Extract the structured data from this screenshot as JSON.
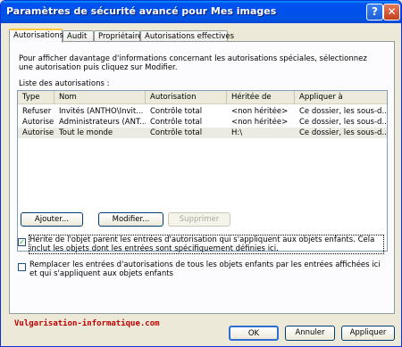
{
  "window": {
    "title": "Paramètres de sécurité avancé pour Mes images"
  },
  "titlebar_buttons": {
    "help": "?",
    "close": "✕"
  },
  "tabs": [
    {
      "label": "Autorisations",
      "active": true
    },
    {
      "label": "Audit",
      "active": false
    },
    {
      "label": "Propriétaire",
      "active": false
    },
    {
      "label": "Autorisations effectives",
      "active": false
    }
  ],
  "intro_text": "Pour afficher davantage d'informations concernant les autorisations spéciales, sélectionnez une autorisation puis cliquez sur Modifier.",
  "list_caption": "Liste des autorisations :",
  "columns": [
    "Type",
    "Nom",
    "Autorisation",
    "Héritée de",
    "Appliquer à"
  ],
  "rows": [
    {
      "type": "Refuser",
      "nom": "Invités (ANTHO\\Invit...",
      "autorisation": "Contrôle total",
      "heritee": "<non héritée>",
      "appliquer": "Ce dossier, les sous-d...",
      "selected": false
    },
    {
      "type": "Autoriser",
      "nom": "Administrateurs (ANT...",
      "autorisation": "Contrôle total",
      "heritee": "<non héritée>",
      "appliquer": "Ce dossier, les sous-d...",
      "selected": false
    },
    {
      "type": "Autoriser",
      "nom": "Tout le monde",
      "autorisation": "Contrôle total",
      "heritee": "H:\\",
      "appliquer": "Ce dossier, les sous-d...",
      "selected": true
    }
  ],
  "list_buttons": {
    "add": "Ajouter...",
    "edit": "Modifier...",
    "remove": "Supprimer"
  },
  "checkboxes": [
    {
      "label": "Hérite de l'objet parent les entrées d'autorisation qui s'appliquent aux objets enfants. Cela inclut les objets dont les entrées sont spécifiquement définies ici.",
      "checked": true
    },
    {
      "label": "Remplacer les entrées d'autorisations de tous les objets enfants par les entrées affichées ici et qui s'appliquent aux objets enfants",
      "checked": false
    }
  ],
  "watermark": "Vulgarisation-informatique.com",
  "footer_buttons": {
    "ok": "OK",
    "cancel": "Annuler",
    "apply": "Appliquer"
  }
}
